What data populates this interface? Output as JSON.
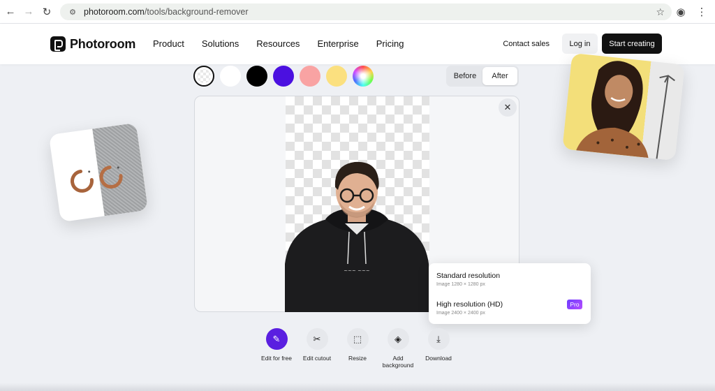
{
  "browser": {
    "url_host": "photoroom.com",
    "url_path": "/tools/background-remover"
  },
  "header": {
    "logo": "Photoroom",
    "nav": [
      "Product",
      "Solutions",
      "Resources",
      "Enterprise",
      "Pricing"
    ],
    "contact": "Contact sales",
    "login": "Log in",
    "start": "Start creating"
  },
  "swatches": [
    {
      "name": "transparent",
      "color": "checker"
    },
    {
      "name": "white",
      "color": "#ffffff"
    },
    {
      "name": "black",
      "color": "#000000"
    },
    {
      "name": "purple",
      "color": "#4b10e0"
    },
    {
      "name": "pink",
      "color": "#f9a3a3"
    },
    {
      "name": "yellow",
      "color": "#fbe07f"
    },
    {
      "name": "rainbow",
      "color": "multicolor"
    }
  ],
  "toggle": {
    "before": "Before",
    "after": "After",
    "active": "After"
  },
  "resolution": {
    "standard_title": "Standard resolution",
    "standard_sub": "Image 1280 × 1280 px",
    "hd_title": "High resolution (HD)",
    "hd_sub": "Image 2400 × 2400 px",
    "badge": "Pro"
  },
  "toolbar": [
    {
      "label": "Edit for free",
      "icon": "pencil-icon"
    },
    {
      "label": "Edit cutout",
      "icon": "scissors-icon"
    },
    {
      "label": "Resize",
      "icon": "resize-icon"
    },
    {
      "label": "Add background",
      "icon": "layers-icon"
    },
    {
      "label": "Download",
      "icon": "download-icon"
    }
  ],
  "colors": {
    "accent": "#5a1fe0",
    "pro_gradient_start": "#6f3cff",
    "pro_gradient_end": "#b44cff"
  }
}
